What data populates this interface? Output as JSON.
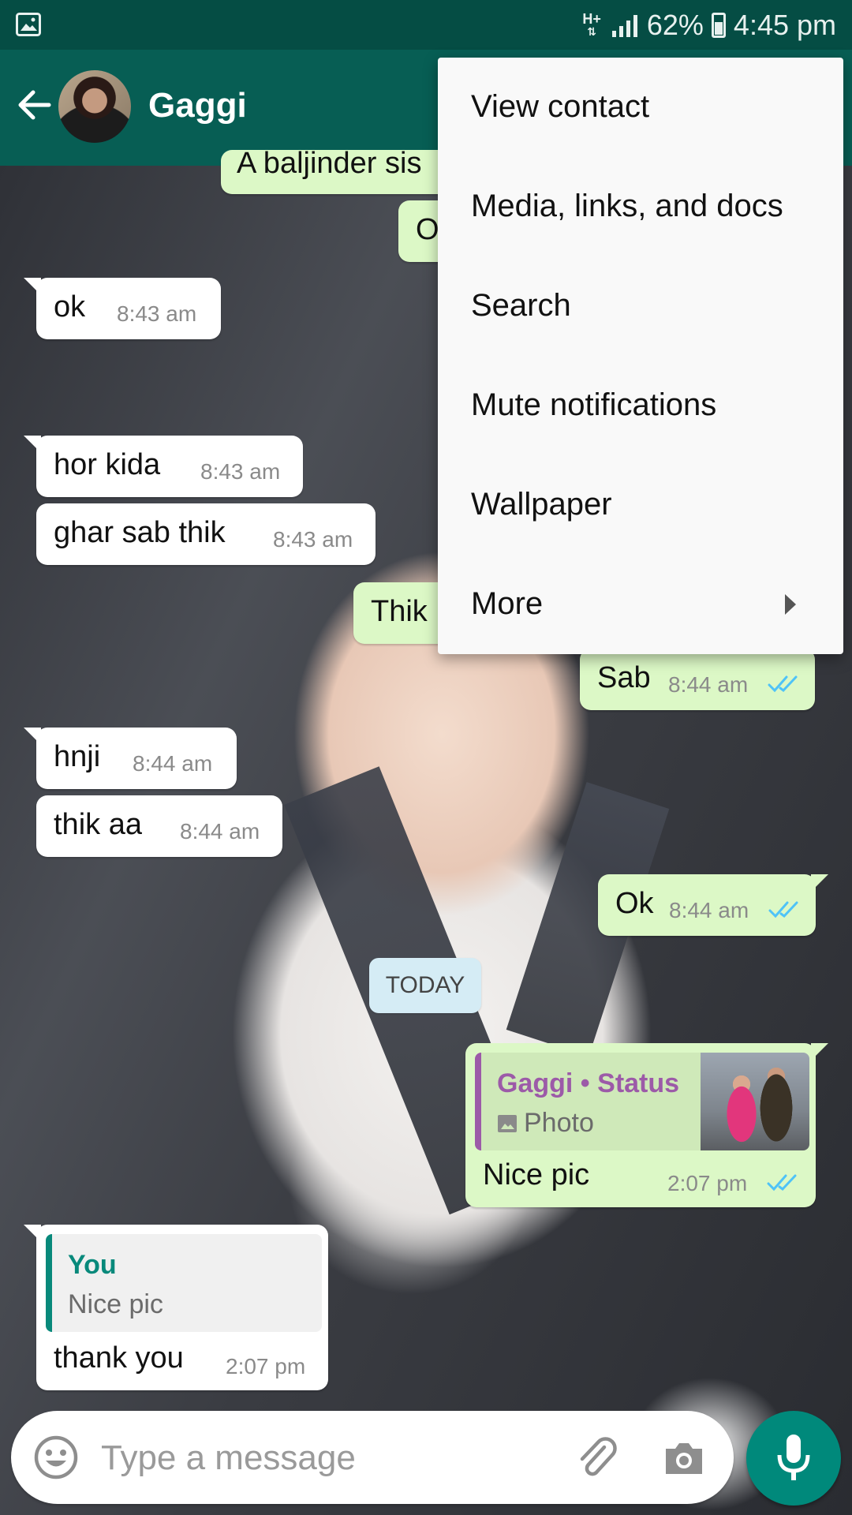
{
  "status_bar": {
    "network": "H+",
    "battery": "62%",
    "time": "4:45 pm"
  },
  "header": {
    "contact_name": "Gaggi"
  },
  "messages": [
    {
      "dir": "partial",
      "text": "A baljinder sis"
    },
    {
      "dir": "partial",
      "text": "O"
    },
    {
      "dir": "in",
      "text": "ok",
      "time": "8:43 am"
    },
    {
      "dir": "in",
      "text": "hor kida",
      "time": "8:43 am"
    },
    {
      "dir": "in",
      "text": "ghar sab thik",
      "time": "8:43 am"
    },
    {
      "dir": "out",
      "text": "Thik",
      "time": ""
    },
    {
      "dir": "out",
      "text": "Sab",
      "time": "8:44 am"
    },
    {
      "dir": "in",
      "text": "hnji",
      "time": "8:44 am"
    },
    {
      "dir": "in",
      "text": "thik aa",
      "time": "8:44 am"
    },
    {
      "dir": "out",
      "text": "Ok",
      "time": "8:44 am"
    },
    {
      "dir": "out",
      "text": "Nice pic",
      "time": "2:07 pm",
      "quote": {
        "name": "Gaggi • Status",
        "sub": "Photo"
      }
    },
    {
      "dir": "in",
      "text": "thank you",
      "time": "2:07 pm",
      "quote": {
        "name": "You",
        "sub": "Nice pic"
      }
    }
  ],
  "date_divider": "TODAY",
  "menu": {
    "items": [
      {
        "label": "View contact"
      },
      {
        "label": "Media, links, and docs"
      },
      {
        "label": "Search"
      },
      {
        "label": "Mute notifications"
      },
      {
        "label": "Wallpaper"
      },
      {
        "label": "More",
        "submenu": true
      }
    ]
  },
  "composer": {
    "placeholder": "Type a message",
    "value": ""
  },
  "icons": [
    "gallery-icon",
    "signal-icon",
    "battery-icon",
    "back-arrow-icon",
    "emoji-icon",
    "attach-icon",
    "camera-icon",
    "mic-icon",
    "double-check-icon",
    "photo-icon",
    "submenu-arrow-icon"
  ],
  "colors": {
    "header": "#075e54",
    "status_bar": "#054d44",
    "outgoing_bubble": "#dcf8c6",
    "incoming_bubble": "#ffffff",
    "read_tick": "#4fc3f7",
    "accent": "#00897b",
    "status_quote": "#9c5aa8"
  }
}
